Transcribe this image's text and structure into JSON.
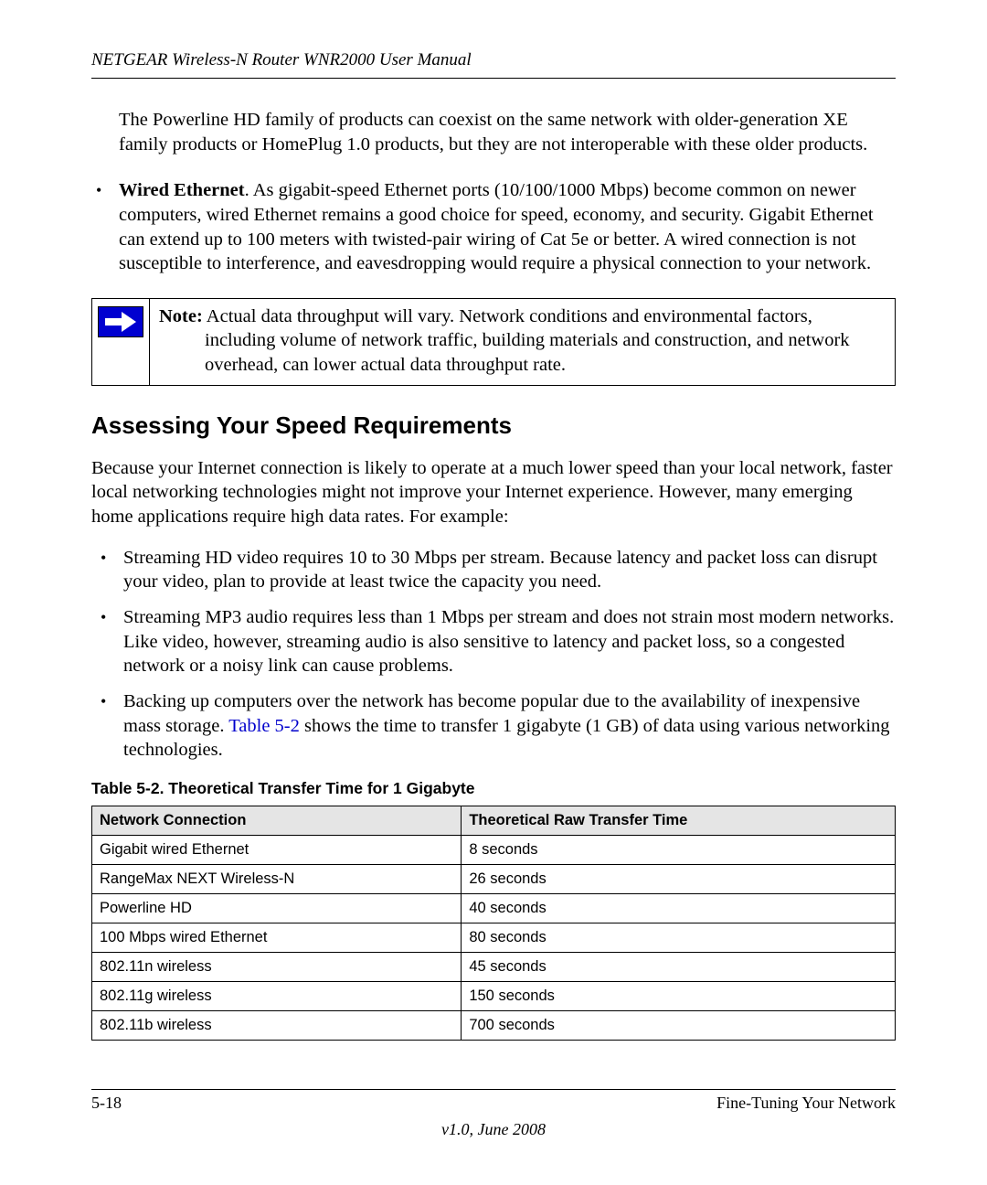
{
  "header": "NETGEAR Wireless-N Router WNR2000 User Manual",
  "para_powerline": "The Powerline HD family of products can coexist on the same network with older-generation XE family products or HomePlug 1.0 products, but they are not interoperable with these older products.",
  "wired_eth": {
    "lead": "Wired Ethernet",
    "text": ". As gigabit-speed Ethernet ports (10/100/1000 Mbps) become common on newer computers, wired Ethernet remains a good choice for speed, economy, and security. Gigabit Ethernet can extend up to 100 meters with twisted-pair wiring of Cat 5e or better. A wired connection is not susceptible to interference, and eavesdropping would require a physical connection to your network."
  },
  "note": {
    "label": "Note:",
    "line1": " Actual data throughput will vary. Network conditions and environmental factors,",
    "line2": "including volume of network traffic, building materials and construction, and network overhead, can lower actual data throughput rate."
  },
  "section_title": "Assessing Your Speed Requirements",
  "section_intro": "Because your Internet connection is likely to operate at a much lower speed than your local network, faster local networking technologies might not improve your Internet experience. However, many emerging home applications require high data rates. For example:",
  "bullets": {
    "b1": "Streaming HD video requires 10 to 30 Mbps per stream. Because latency and packet loss can disrupt your video, plan to provide at least twice the capacity you need.",
    "b2": "Streaming MP3 audio requires less than 1 Mbps per stream and does not strain most modern networks. Like video, however, streaming audio is also sensitive to latency and packet loss, so a congested network or a noisy link can cause problems.",
    "b3a": "Backing up computers over the network has become popular due to the availability of inexpensive mass storage. ",
    "b3link": "Table 5-2",
    "b3b": " shows the time to transfer 1 gigabyte (1 GB) of data using various networking technologies."
  },
  "table": {
    "caption": "Table 5-2.  Theoretical Transfer Time for 1 Gigabyte",
    "col1": "Network Connection",
    "col2": "Theoretical Raw Transfer Time",
    "rows": [
      {
        "c1": "Gigabit wired Ethernet",
        "c2": "8 seconds"
      },
      {
        "c1": "RangeMax NEXT Wireless-N",
        "c2": "26 seconds"
      },
      {
        "c1": "Powerline HD",
        "c2": "40 seconds"
      },
      {
        "c1": "100 Mbps wired Ethernet",
        "c2": "80 seconds"
      },
      {
        "c1": "802.11n wireless",
        "c2": "45 seconds"
      },
      {
        "c1": "802.11g wireless",
        "c2": "150 seconds"
      },
      {
        "c1": "802.11b wireless",
        "c2": "700 seconds"
      }
    ]
  },
  "footer": {
    "page": "5-18",
    "section": "Fine-Tuning Your Network",
    "version": "v1.0, June 2008"
  }
}
